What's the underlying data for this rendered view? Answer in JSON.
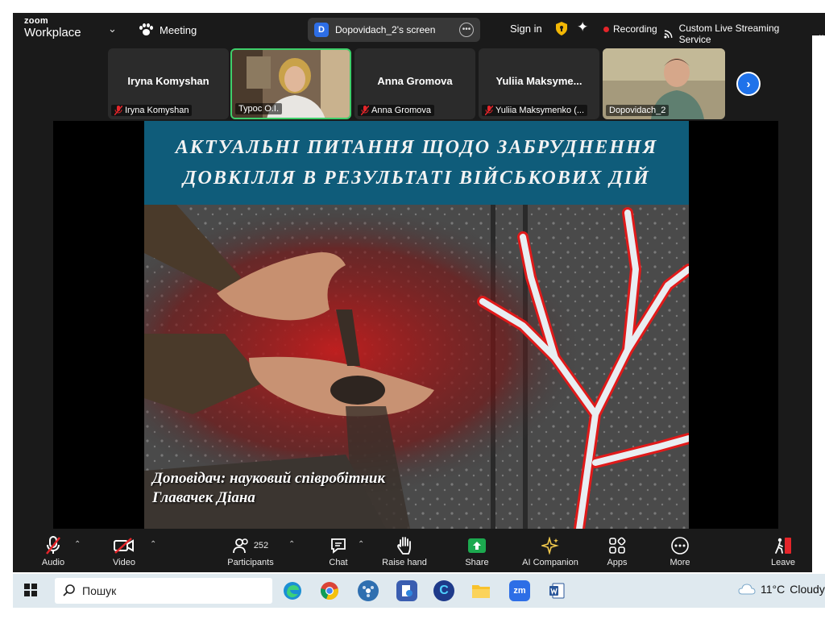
{
  "app": {
    "brand_top": "zoom",
    "brand_bottom": "Workplace"
  },
  "topbar": {
    "meeting_label": "Meeting",
    "share_badge": "D",
    "share_label": "Dopovidach_2's screen",
    "signin_label": "Sign in",
    "recording_label": "Recording",
    "live_label": "Custom Live Streaming Service"
  },
  "participants": [
    {
      "display": "Iryna Komyshan",
      "label": "Iryna Komyshan",
      "muted": true,
      "video": false
    },
    {
      "display": "",
      "label": "Турос О.І.",
      "muted": false,
      "video": true,
      "active": true
    },
    {
      "display": "Anna Gromova",
      "label": "Anna Gromova",
      "muted": true,
      "video": false
    },
    {
      "display": "Yuliia  Maksyme...",
      "label": "Yuliia Maksymenko (...",
      "muted": true,
      "video": false
    },
    {
      "display": "",
      "label": "Dopovidach_2",
      "muted": false,
      "video": true
    }
  ],
  "slide": {
    "title_line1": "АКТУАЛЬНІ ПИТАННЯ ЩОДО ЗАБРУДНЕННЯ",
    "title_line2": "ДОВКІЛЛЯ В РЕЗУЛЬТАТІ ВІЙСЬКОВИХ ДІЙ",
    "speaker_line1": "Доповідач: науковий співробітник",
    "speaker_line2": "Главачек Діана",
    "title_bg": "#0f5c7a"
  },
  "toolbar": {
    "audio": "Audio",
    "video": "Video",
    "participants": "Participants",
    "participants_count": "252",
    "chat": "Chat",
    "raise_hand": "Raise hand",
    "share": "Share",
    "ai_companion": "AI Companion",
    "apps": "Apps",
    "more": "More",
    "leave": "Leave",
    "share_color": "#1ca94f",
    "leave_color": "#e5252a"
  },
  "taskbar": {
    "search_placeholder": "Пошук",
    "temperature": "11°C",
    "weather": "Cloudy"
  }
}
